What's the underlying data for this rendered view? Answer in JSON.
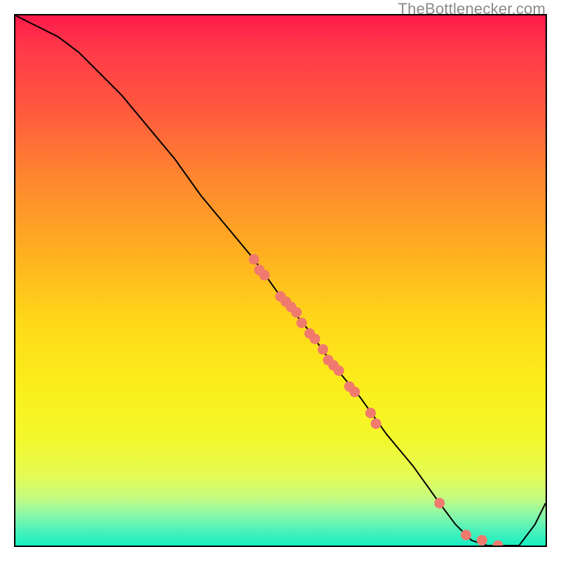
{
  "watermark": "TheBottlenecker.com",
  "chart_data": {
    "type": "line",
    "title": "",
    "xlabel": "",
    "ylabel": "",
    "xlim": [
      0,
      100
    ],
    "ylim": [
      0,
      100
    ],
    "series": [
      {
        "name": "bottleneck-curve",
        "x": [
          0,
          4,
          8,
          12,
          16,
          20,
          25,
          30,
          35,
          40,
          45,
          50,
          55,
          60,
          65,
          70,
          75,
          80,
          83,
          86,
          89,
          92,
          95,
          98,
          100
        ],
        "y": [
          100,
          98,
          96,
          93,
          89,
          85,
          79,
          73,
          66,
          60,
          54,
          47,
          41,
          34,
          28,
          21,
          15,
          8,
          4,
          1,
          0,
          0,
          0,
          4,
          8
        ]
      }
    ],
    "scatter": {
      "name": "gpu-points",
      "color": "#f07a6e",
      "points": [
        {
          "x": 45,
          "y": 54
        },
        {
          "x": 46,
          "y": 52
        },
        {
          "x": 47,
          "y": 51
        },
        {
          "x": 50,
          "y": 47
        },
        {
          "x": 51,
          "y": 46
        },
        {
          "x": 52,
          "y": 45
        },
        {
          "x": 53,
          "y": 44
        },
        {
          "x": 54,
          "y": 42
        },
        {
          "x": 55.5,
          "y": 40
        },
        {
          "x": 56.5,
          "y": 39
        },
        {
          "x": 58,
          "y": 37
        },
        {
          "x": 59,
          "y": 35
        },
        {
          "x": 60,
          "y": 34
        },
        {
          "x": 61,
          "y": 33
        },
        {
          "x": 63,
          "y": 30
        },
        {
          "x": 64,
          "y": 29
        },
        {
          "x": 67,
          "y": 25
        },
        {
          "x": 68,
          "y": 23
        },
        {
          "x": 80,
          "y": 8
        },
        {
          "x": 85,
          "y": 2
        },
        {
          "x": 88,
          "y": 1
        },
        {
          "x": 91,
          "y": 0
        }
      ]
    },
    "background": {
      "type": "vertical-gradient",
      "stops": [
        {
          "pos": 0.0,
          "color": "#ff1a4a"
        },
        {
          "pos": 0.5,
          "color": "#ffcc1c"
        },
        {
          "pos": 0.8,
          "color": "#f3f82c"
        },
        {
          "pos": 1.0,
          "color": "#17eec2"
        }
      ]
    }
  }
}
